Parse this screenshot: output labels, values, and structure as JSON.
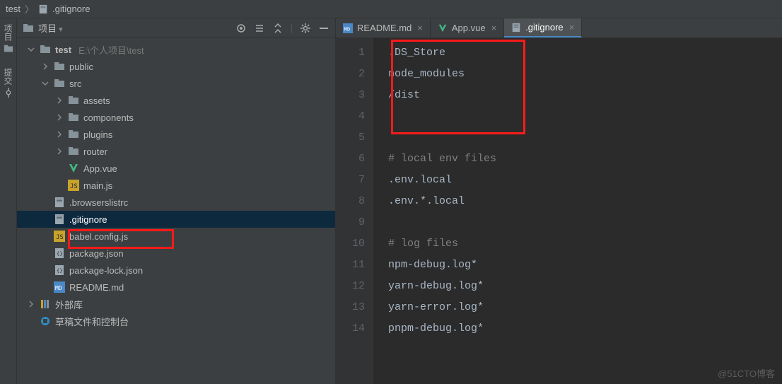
{
  "breadcrumb": {
    "root": "test",
    "file": ".gitignore"
  },
  "rails": {
    "project": "项目",
    "commit": "提交"
  },
  "panel": {
    "title": "项目"
  },
  "tree": {
    "root": {
      "label": "test",
      "path": "E:\\个人项目\\test"
    },
    "nodes": [
      {
        "label": "public",
        "type": "folder",
        "indent": 1,
        "chev": "right"
      },
      {
        "label": "src",
        "type": "folder",
        "indent": 1,
        "chev": "down"
      },
      {
        "label": "assets",
        "type": "folder",
        "indent": 2,
        "chev": "right"
      },
      {
        "label": "components",
        "type": "folder",
        "indent": 2,
        "chev": "right"
      },
      {
        "label": "plugins",
        "type": "folder",
        "indent": 2,
        "chev": "right"
      },
      {
        "label": "router",
        "type": "folder",
        "indent": 2,
        "chev": "right"
      },
      {
        "label": "App.vue",
        "type": "vue",
        "indent": 2
      },
      {
        "label": "main.js",
        "type": "js",
        "indent": 2
      },
      {
        "label": ".browserslistrc",
        "type": "txt",
        "indent": 1
      },
      {
        "label": ".gitignore",
        "type": "txt",
        "indent": 1,
        "selected": true
      },
      {
        "label": "babel.config.js",
        "type": "js",
        "indent": 1
      },
      {
        "label": "package.json",
        "type": "json",
        "indent": 1
      },
      {
        "label": "package-lock.json",
        "type": "json",
        "indent": 1
      },
      {
        "label": "README.md",
        "type": "md",
        "indent": 1
      }
    ],
    "external": "外部库",
    "scratch": "草稿文件和控制台"
  },
  "tabs": [
    {
      "label": "README.md",
      "type": "md"
    },
    {
      "label": "App.vue",
      "type": "vue"
    },
    {
      "label": ".gitignore",
      "type": "txt",
      "active": true
    }
  ],
  "editor": {
    "lines": [
      ".DS_Store",
      "node_modules",
      "/dist",
      "",
      "",
      "# local env files",
      ".env.local",
      ".env.*.local",
      "",
      "# log files",
      "npm-debug.log*",
      "yarn-debug.log*",
      "yarn-error.log*",
      "pnpm-debug.log*"
    ]
  },
  "watermark": "@51CTO博客"
}
